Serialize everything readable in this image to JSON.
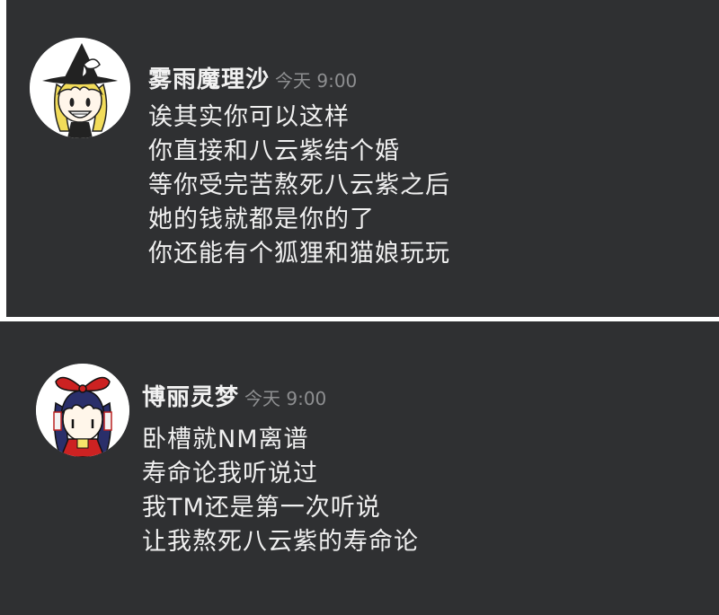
{
  "messages": [
    {
      "username": "雾雨魔理沙",
      "timestamp": "今天 9:00",
      "avatar_icon": "witch-girl-avatar-icon",
      "lines": [
        "诶其实你可以这样",
        "你直接和八云紫结个婚",
        "等你受完苦熬死八云紫之后",
        "她的钱就都是你的了",
        "你还能有个狐狸和猫娘玩玩"
      ]
    },
    {
      "username": "博丽灵梦",
      "timestamp": "今天 9:00",
      "avatar_icon": "shrine-maiden-avatar-icon",
      "lines": [
        "卧槽就NM离谱",
        "寿命论我听说过",
        "我TM还是第一次听说",
        "让我熬死八云紫的寿命论"
      ]
    }
  ],
  "colors": {
    "background": "#2f3032",
    "username": "#f2f2f2",
    "timestamp": "#8e8f91",
    "message_text": "#f0f0f0"
  }
}
